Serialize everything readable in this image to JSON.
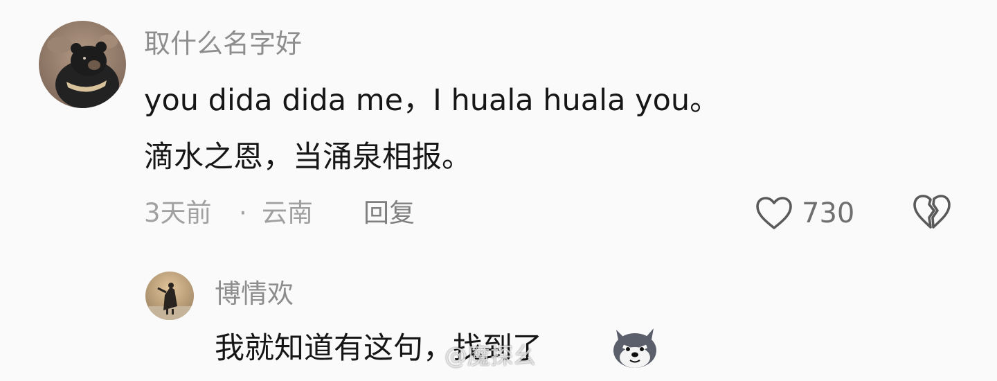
{
  "comment": {
    "username": "取什么名字好",
    "content_lines": [
      "you dida dida me，I huala huala you。",
      "滴水之恩，当涌泉相报。"
    ],
    "time": "3天前",
    "separator": "·",
    "location": "云南",
    "reply_label": "回复",
    "like_count": "730",
    "icons": {
      "like": "heart-outline-icon",
      "dislike": "broken-heart-icon"
    }
  },
  "reply": {
    "username": "博情欢",
    "content": "我就知道有这句，找到了",
    "emoji": "doge-dog-emoji"
  },
  "watermark": "@魔探幺",
  "colors": {
    "background": "#fafafa",
    "username": "#8d8d8d",
    "text": "#161616",
    "meta": "#a0a0a0",
    "icon": "#5a5a5a"
  }
}
